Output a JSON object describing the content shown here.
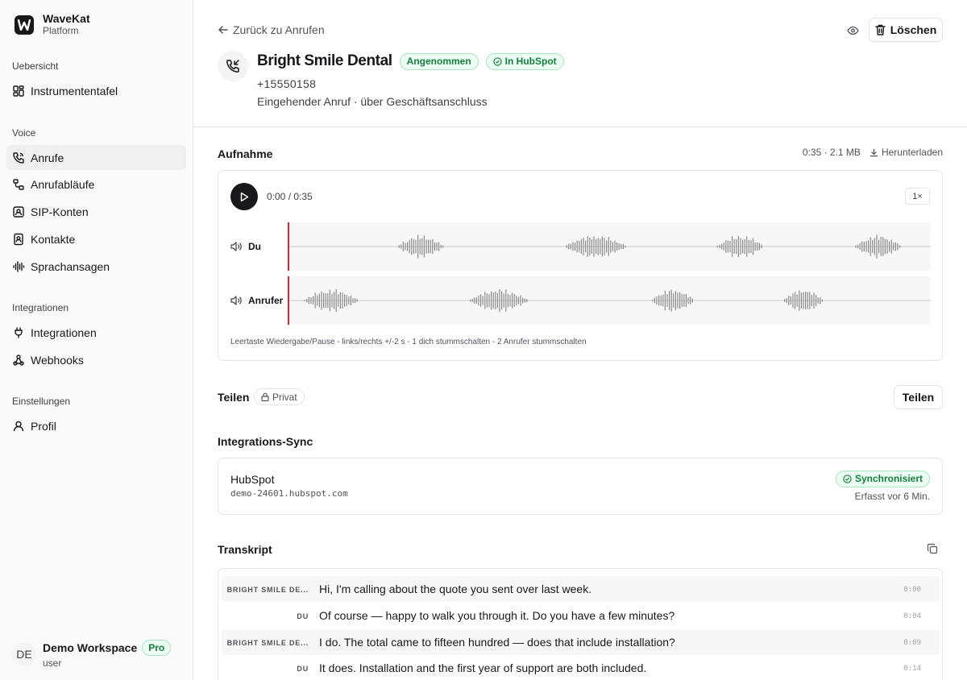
{
  "brand": {
    "name": "WaveKat",
    "subtitle": "Platform"
  },
  "sidebar": {
    "sections": [
      {
        "label": "Uebersicht"
      },
      {
        "label": "Voice"
      },
      {
        "label": "Integrationen"
      },
      {
        "label": "Einstellungen"
      }
    ],
    "items": [
      {
        "label": "Instrumententafel",
        "icon": "dashboard-icon"
      },
      {
        "label": "Anrufe",
        "icon": "phone-icon",
        "active": true
      },
      {
        "label": "Anrufabläufe",
        "icon": "flow-icon"
      },
      {
        "label": "SIP-Konten",
        "icon": "contact-card-icon"
      },
      {
        "label": "Kontakte",
        "icon": "contact-book-icon"
      },
      {
        "label": "Sprachansagen",
        "icon": "audio-lines-icon"
      },
      {
        "label": "Integrationen",
        "icon": "plug-icon"
      },
      {
        "label": "Webhooks",
        "icon": "webhook-icon"
      },
      {
        "label": "Profil",
        "icon": "user-icon"
      }
    ]
  },
  "user": {
    "initials": "DE",
    "workspace": "Demo Workspace",
    "plan": "Pro",
    "role": "user"
  },
  "header": {
    "back_label": "Zurück zu Anrufen",
    "delete_label": "Löschen",
    "title": "Bright Smile Dental",
    "status_badge": "Angenommen",
    "crm_badge": "In HubSpot",
    "number": "+15550158",
    "meta": "Eingehender Anruf · über Geschäftsanschluss"
  },
  "recording": {
    "title": "Aufnahme",
    "info": "0:35 · 2.1 MB",
    "download_label": "Herunterladen",
    "time": "0:00 / 0:35",
    "speed": "1×",
    "tracks": [
      {
        "label": "Du"
      },
      {
        "label": "Anrufer"
      }
    ],
    "hint": "Leertaste Wiedergabe/Pause - links/rechts +/-2 s - 1 dich stummschalten - 2 Anrufer stummschalten"
  },
  "share": {
    "label": "Teilen",
    "visibility": "Privat",
    "button_label": "Teilen"
  },
  "sync": {
    "title": "Integrations-Sync",
    "name": "HubSpot",
    "domain": "demo-24601.hubspot.com",
    "status": "Synchronisiert",
    "time": "Erfasst vor 6 Min."
  },
  "transcript": {
    "title": "Transkript",
    "rows": [
      {
        "speaker": "BRIGHT SMILE DE...",
        "text": "Hi, I'm calling about the quote you sent over last week.",
        "time": "0:00"
      },
      {
        "speaker": "DU",
        "text": "Of course — happy to walk you through it. Do you have a few minutes?",
        "time": "0:04"
      },
      {
        "speaker": "BRIGHT SMILE DE...",
        "text": "I do. The total came to fifteen hundred — does that include installation?",
        "time": "0:09"
      },
      {
        "speaker": "DU",
        "text": "It does. Installation and the first year of support are both included.",
        "time": "0:14"
      }
    ]
  },
  "colors": {
    "accent": "#18181b",
    "success": "#15803d",
    "success_bg": "#ecfdf3",
    "playhead": "#dc2626",
    "waveform": "#8a8a8a"
  }
}
